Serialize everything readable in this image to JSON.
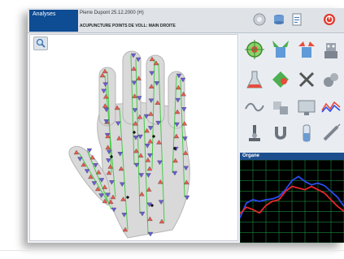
{
  "header": {
    "tab_label": "Analyses",
    "patient": "Pierre Dupont   25.12.2000 (H)",
    "subtitle": "ACUPUNCTURE POINTS DE VOLL: MAIN DROITE"
  },
  "left_panel": {
    "zoom_icon": "magnifier-icon"
  },
  "tools": [
    "target-icon",
    "arrows-in-icon",
    "arrows-out-icon",
    "robot-icon",
    "flask-icon",
    "diamond-icon",
    "close-x-icon",
    "spheres-icon",
    "wave-icon",
    "puzzle-icon",
    "monitor-icon",
    "multi-wave-icon",
    "microscope-icon",
    "magnet-icon",
    "vial-icon",
    "syringe-icon"
  ],
  "organ": {
    "title": "Organe"
  },
  "colors": {
    "tab": "#0e4c93",
    "organ_bg": "#000000",
    "grid": "#1fa84a",
    "series_blue": "#2a4cf0",
    "series_red": "#e8262a",
    "point_red": "#e85a4e",
    "point_blue": "#6b5bd6",
    "meridian": "#44cc44"
  },
  "chart_data": {
    "type": "line",
    "series": [
      {
        "values": [
          0.3,
          0.48,
          0.52,
          0.5,
          0.52,
          0.53,
          0.56,
          0.64,
          0.75,
          0.8,
          0.74,
          0.7,
          0.72,
          0.69,
          0.62,
          0.55,
          0.44
        ]
      },
      {
        "values": [
          0.35,
          0.43,
          0.4,
          0.36,
          0.45,
          0.5,
          0.52,
          0.62,
          0.68,
          0.66,
          0.64,
          0.68,
          0.64,
          0.6,
          0.52,
          0.44,
          0.38
        ]
      }
    ]
  }
}
